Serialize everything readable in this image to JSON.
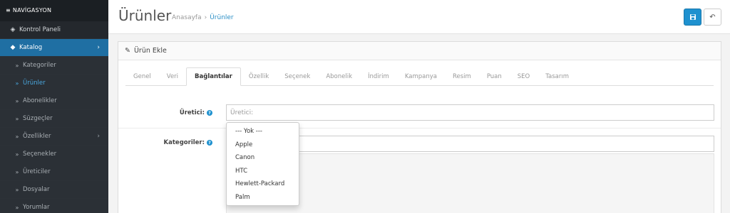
{
  "sidebar": {
    "header": "NAVİGASYON",
    "items": [
      {
        "label": "Kontrol Paneli"
      },
      {
        "label": "Katalog"
      },
      {
        "label": "Kategoriler"
      },
      {
        "label": "Ürünler"
      },
      {
        "label": "Abonelikler"
      },
      {
        "label": "Süzgeçler"
      },
      {
        "label": "Özellikler"
      },
      {
        "label": "Seçenekler"
      },
      {
        "label": "Üreticiler"
      },
      {
        "label": "Dosyalar"
      },
      {
        "label": "Yorumlar"
      }
    ]
  },
  "header": {
    "title": "Ürünler",
    "breadcrumb": [
      "Anasayfa",
      "›",
      "Ürünler"
    ]
  },
  "panel": {
    "title": "Ürün Ekle"
  },
  "tabs": [
    "Genel",
    "Veri",
    "Bağlantılar",
    "Özellik",
    "Seçenek",
    "Abonelik",
    "İndirim",
    "Kampanya",
    "Resim",
    "Puan",
    "SEO",
    "Tasarım"
  ],
  "form": {
    "manufacturer_label": "Üretici:",
    "manufacturer_placeholder": "Üretici:",
    "manufacturer_value": "",
    "category_label": "Kategoriler:"
  },
  "dropdown": [
    "--- Yok ---",
    "Apple",
    "Canon",
    "HTC",
    "Hewlett-Packard",
    "Palm"
  ],
  "colors": {
    "accent": "#1e91cf",
    "sidebar_bg": "#24282d",
    "active_nav": "#1f6fa3"
  }
}
